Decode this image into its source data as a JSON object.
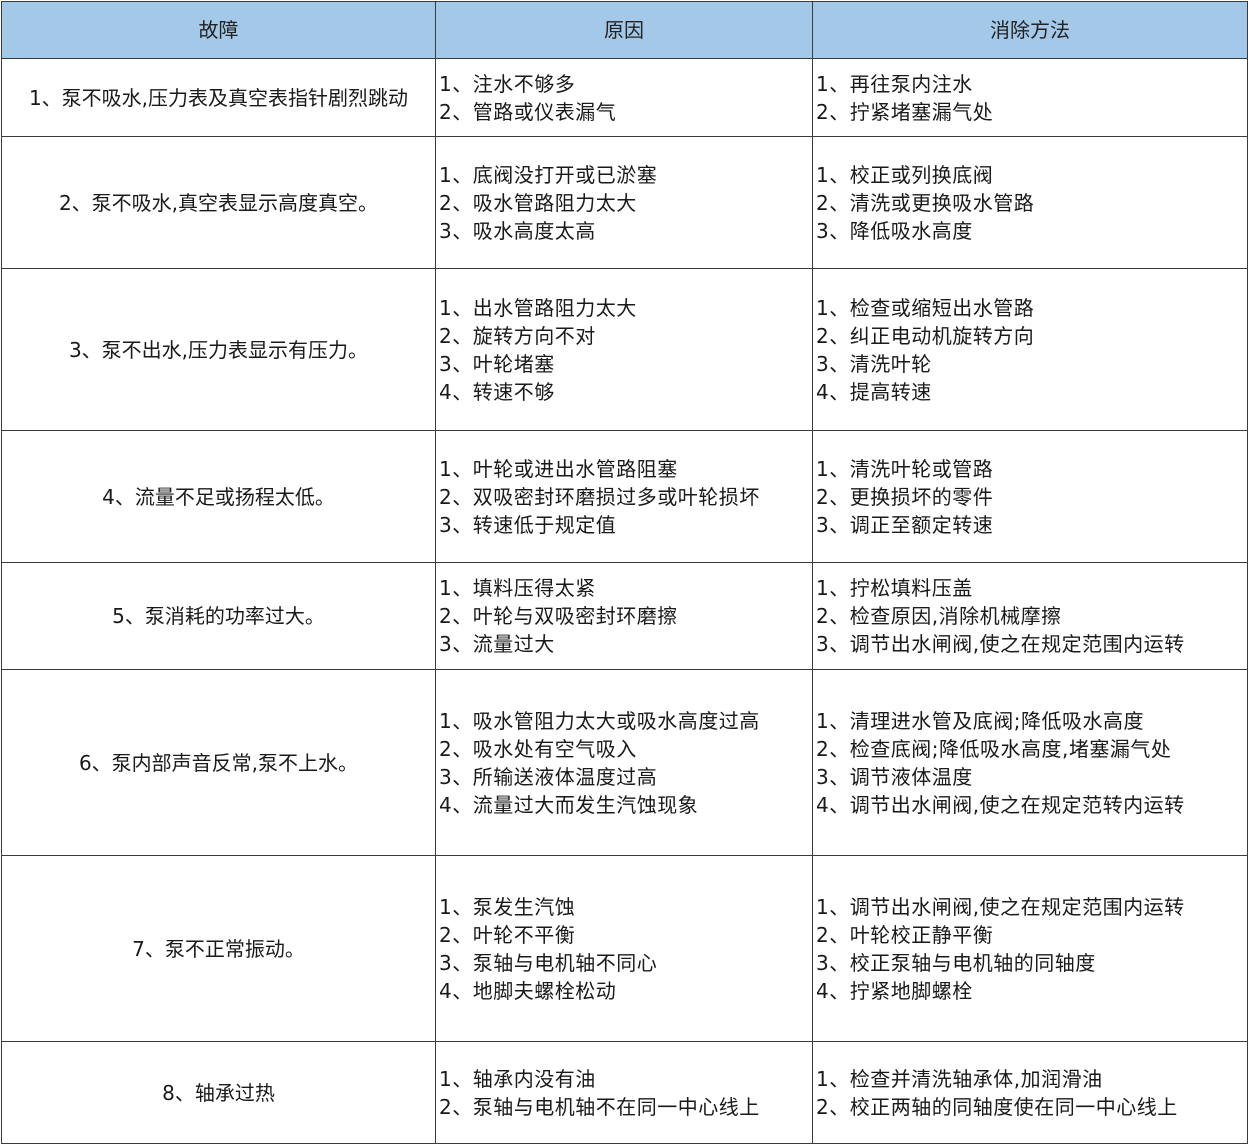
{
  "header": {
    "fault": "故障",
    "cause": "原因",
    "remedy": "消除方法"
  },
  "rows": [
    {
      "fault": "1、泵不吸水,压力表及真空表指针剧烈跳动",
      "causes": [
        "1、注水不够多",
        "2、管路或仪表漏气"
      ],
      "remedies": [
        "1、再往泵内注水",
        "2、拧紧堵塞漏气处"
      ]
    },
    {
      "fault": "2、泵不吸水,真空表显示高度真空。",
      "causes": [
        "1、底阀没打开或已淤塞",
        "2、吸水管路阻力太大",
        "3、吸水高度太高"
      ],
      "remedies": [
        "1、校正或列换底阀",
        "2、清洗或更换吸水管路",
        "3、降低吸水高度"
      ]
    },
    {
      "fault": "3、泵不出水,压力表显示有压力。",
      "causes": [
        "1、出水管路阻力太大",
        "2、旋转方向不对",
        "3、叶轮堵塞",
        "4、转速不够"
      ],
      "remedies": [
        "1、检查或缩短出水管路",
        "2、纠正电动机旋转方向",
        "3、清洗叶轮",
        "4、提高转速"
      ]
    },
    {
      "fault": "4、流量不足或扬程太低。",
      "causes": [
        "1、叶轮或进出水管路阻塞",
        "2、双吸密封环磨损过多或叶轮损坏",
        "3、转速低于规定值"
      ],
      "remedies": [
        "1、清洗叶轮或管路",
        "2、更换损坏的零件",
        "3、调正至额定转速"
      ]
    },
    {
      "fault": "5、泵消耗的功率过大。",
      "causes": [
        "1、填料压得太紧",
        "2、叶轮与双吸密封环磨擦",
        "3、流量过大"
      ],
      "remedies": [
        "1、拧松填料压盖",
        "2、检查原因,消除机械摩擦",
        "3、调节出水闸阀,使之在规定范围内运转"
      ]
    },
    {
      "fault": "6、泵内部声音反常,泵不上水。",
      "causes": [
        "1、吸水管阻力太大或吸水高度过高",
        "2、吸水处有空气吸入",
        "3、所输送液体温度过高",
        "4、流量过大而发生汽蚀现象"
      ],
      "remedies": [
        "1、清理进水管及底阀;降低吸水高度",
        "2、检查底阀;降低吸水高度,堵塞漏气处",
        "3、调节液体温度",
        "4、调节出水闸阀,使之在规定范转内运转"
      ]
    },
    {
      "fault": "7、泵不正常振动。",
      "causes": [
        "1、泵发生汽蚀",
        "2、叶轮不平衡",
        "3、泵轴与电机轴不同心",
        "4、地脚夫螺栓松动"
      ],
      "remedies": [
        "1、调节出水闸阀,使之在规定范围内运转",
        "2、叶轮校正静平衡",
        "3、校正泵轴与电机轴的同轴度",
        "4、拧紧地脚螺栓"
      ]
    },
    {
      "fault": "8、轴承过热",
      "causes": [
        "1、轴承内没有油",
        "2、泵轴与电机轴不在同一中心线上"
      ],
      "remedies": [
        "1、检查并清洗轴承体,加润滑油",
        "2、校正两轴的同轴度使在同一中心线上"
      ]
    }
  ]
}
